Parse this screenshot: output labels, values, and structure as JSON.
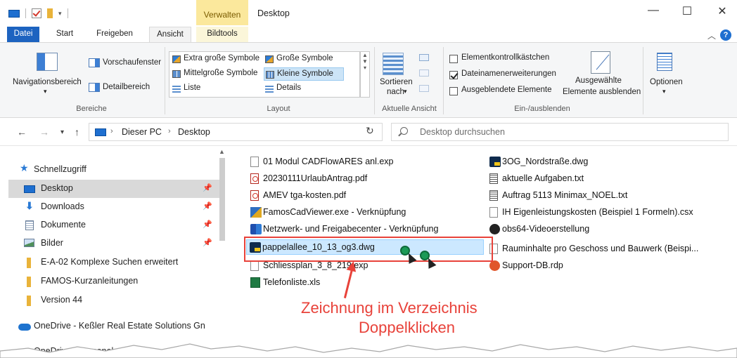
{
  "window": {
    "title": "Desktop",
    "context_tab": "Verwalten",
    "min": "—",
    "max": "☐",
    "close": "✕"
  },
  "tabs": [
    "Datei",
    "Start",
    "Freigeben",
    "Ansicht",
    "Bildtools"
  ],
  "ribbon": {
    "bereiche": {
      "label": "Bereiche",
      "navigationsbereich": "Navigationsbereich",
      "vorschaufenster": "Vorschaufenster",
      "detailbereich": "Detailbereich"
    },
    "layout": {
      "label": "Layout",
      "items": [
        "Extra große Symbole",
        "Große Symbole",
        "Mittelgroße Symbole",
        "Kleine Symbole",
        "Liste",
        "Details"
      ],
      "selected": "Kleine Symbole"
    },
    "aktuelle_ansicht": {
      "label": "Aktuelle Ansicht",
      "sortieren": "Sortieren",
      "nach": "nach"
    },
    "ein_ausblenden": {
      "label": "Ein-/ausblenden",
      "elementkontrollkaestchen": "Elementkontrollkästchen",
      "dateinamenerweiterungen": "Dateinamenerweiterungen",
      "ausgeblendete_elemente": "Ausgeblendete Elemente",
      "ausgewaehlte_line1": "Ausgewählte",
      "ausgewaehlte_line2": "Elemente ausblenden",
      "checks": {
        "elementkontrollkaestchen": false,
        "dateinamenerweiterungen": true,
        "ausgeblendete_elemente": false
      }
    },
    "optionen": "Optionen"
  },
  "address": {
    "crumbs": [
      "Dieser PC",
      "Desktop"
    ],
    "search_placeholder": "Desktop durchsuchen"
  },
  "nav": {
    "items": [
      {
        "label": "Schnellzugriff",
        "icon": "star-icon"
      },
      {
        "label": "Desktop",
        "icon": "desktop-icon",
        "selected": true,
        "pinned": true
      },
      {
        "label": "Downloads",
        "icon": "download-icon",
        "pinned": true
      },
      {
        "label": "Dokumente",
        "icon": "document-icon",
        "pinned": true
      },
      {
        "label": "Bilder",
        "icon": "pictures-icon",
        "pinned": true
      },
      {
        "label": "E-A-02 Komplexe Suchen erweitert",
        "icon": "folder-icon"
      },
      {
        "label": "FAMOS-Kurzanleitungen",
        "icon": "folder-icon"
      },
      {
        "label": "Version 44",
        "icon": "folder-icon"
      },
      {
        "label": "OneDrive - Keßler Real Estate Solutions Gn",
        "icon": "onedrive-icon"
      },
      {
        "label": "OneDrive - Personal",
        "icon": "onedrive-icon"
      }
    ]
  },
  "files": {
    "col1": [
      {
        "name": "01 Modul  CADFlowARES anl.exp",
        "icon": "blank-file-icon"
      },
      {
        "name": "20230111UrlaubAntrag.pdf",
        "icon": "pdf-icon"
      },
      {
        "name": "AMEV tga-kosten.pdf",
        "icon": "pdf-icon"
      },
      {
        "name": "FamosCadViewer.exe - Verknüpfung",
        "icon": "famos-icon"
      },
      {
        "name": "Netzwerk- und Freigabecenter - Verknüpfung",
        "icon": "network-icon"
      },
      {
        "name": "pappelallee_10_13_og3.dwg",
        "icon": "dwg-icon",
        "selected": true
      },
      {
        "name": "Schliessplan_3_8_219.exp",
        "icon": "blank-file-icon"
      },
      {
        "name": "Telefonliste.xls",
        "icon": "excel-icon"
      }
    ],
    "col2": [
      {
        "name": "3OG_Nordstraße.dwg",
        "icon": "dwg-icon"
      },
      {
        "name": "aktuelle Aufgaben.txt",
        "icon": "text-file-icon"
      },
      {
        "name": "Auftrag 5113 Minimax_NOEL.txt",
        "icon": "text-file-icon"
      },
      {
        "name": "IH Eigenleistungskosten (Beispiel 1 Formeln).csx",
        "icon": "blank-file-icon"
      },
      {
        "name": "obs64-Videoerstellung",
        "icon": "obs-icon"
      },
      {
        "name": "Rauminhalte pro Geschoss und Bauwerk (Beispi...",
        "icon": "blank-file-icon"
      },
      {
        "name": "Support-DB.rdp",
        "icon": "rdp-icon"
      }
    ]
  },
  "annotation": {
    "line1": "Zeichnung im Verzeichnis",
    "line2": "Doppelklicken",
    "color": "#e8423a"
  }
}
